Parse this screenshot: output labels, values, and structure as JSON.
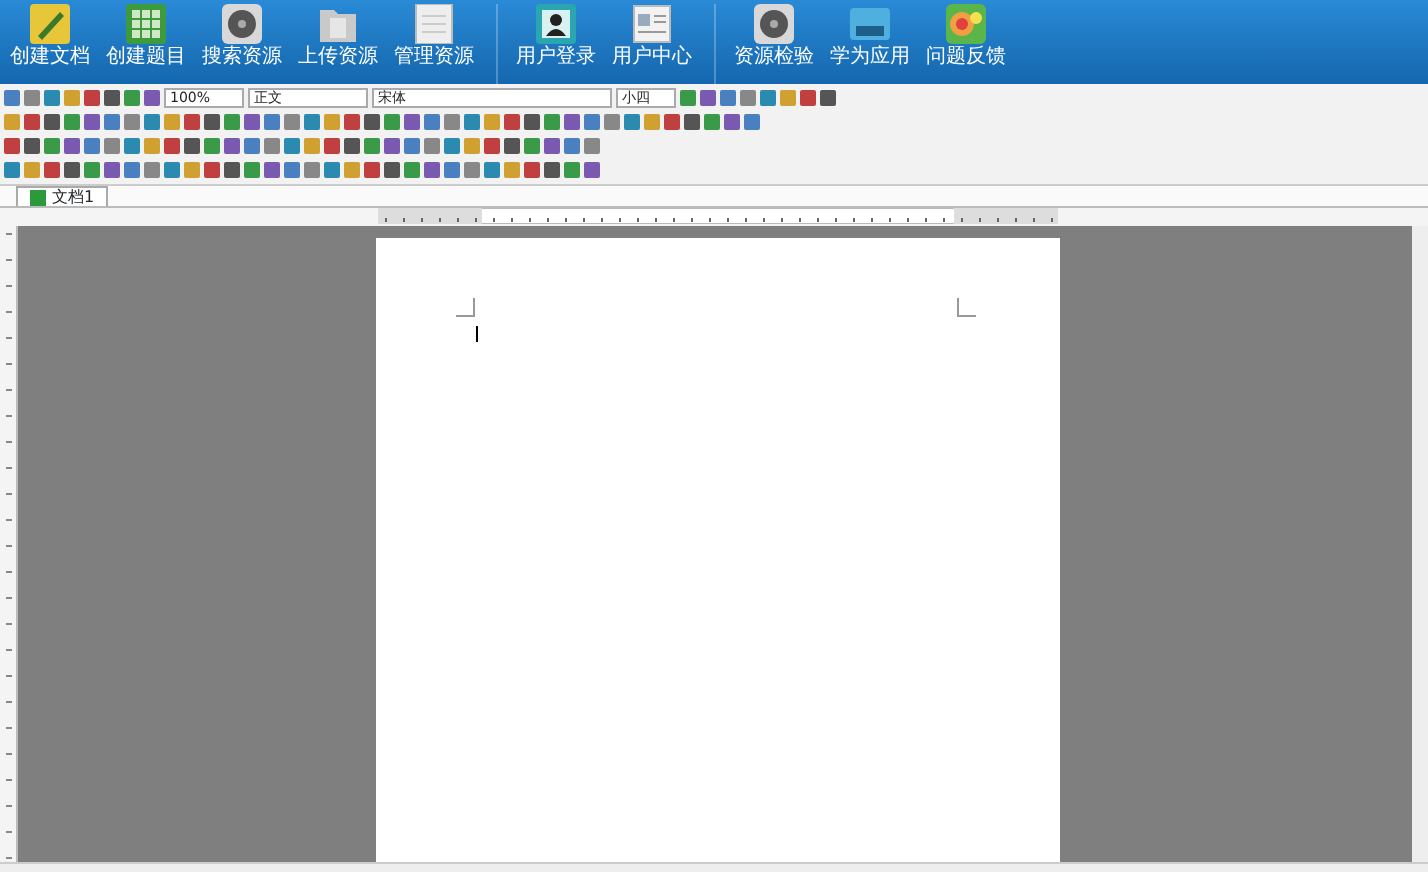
{
  "app_bar": {
    "groups": [
      {
        "items": [
          {
            "label": "创建文档",
            "kind": "pencil"
          },
          {
            "label": "创建题目",
            "kind": "grid"
          },
          {
            "label": "搜索资源",
            "kind": "disc"
          },
          {
            "label": "上传资源",
            "kind": "folder"
          },
          {
            "label": "管理资源",
            "kind": "sheet"
          }
        ]
      },
      {
        "items": [
          {
            "label": "用户登录",
            "kind": "person"
          },
          {
            "label": "用户中心",
            "kind": "card"
          }
        ]
      },
      {
        "items": [
          {
            "label": "资源检验",
            "kind": "disc"
          },
          {
            "label": "学为应用",
            "kind": "screen"
          },
          {
            "label": "问题反馈",
            "kind": "faces"
          }
        ]
      }
    ]
  },
  "toolbar": {
    "zoom": "100%",
    "style": "正文",
    "font": "宋体",
    "size": "小四"
  },
  "document_tabs": [
    {
      "label": "文档1",
      "selected": true
    }
  ]
}
